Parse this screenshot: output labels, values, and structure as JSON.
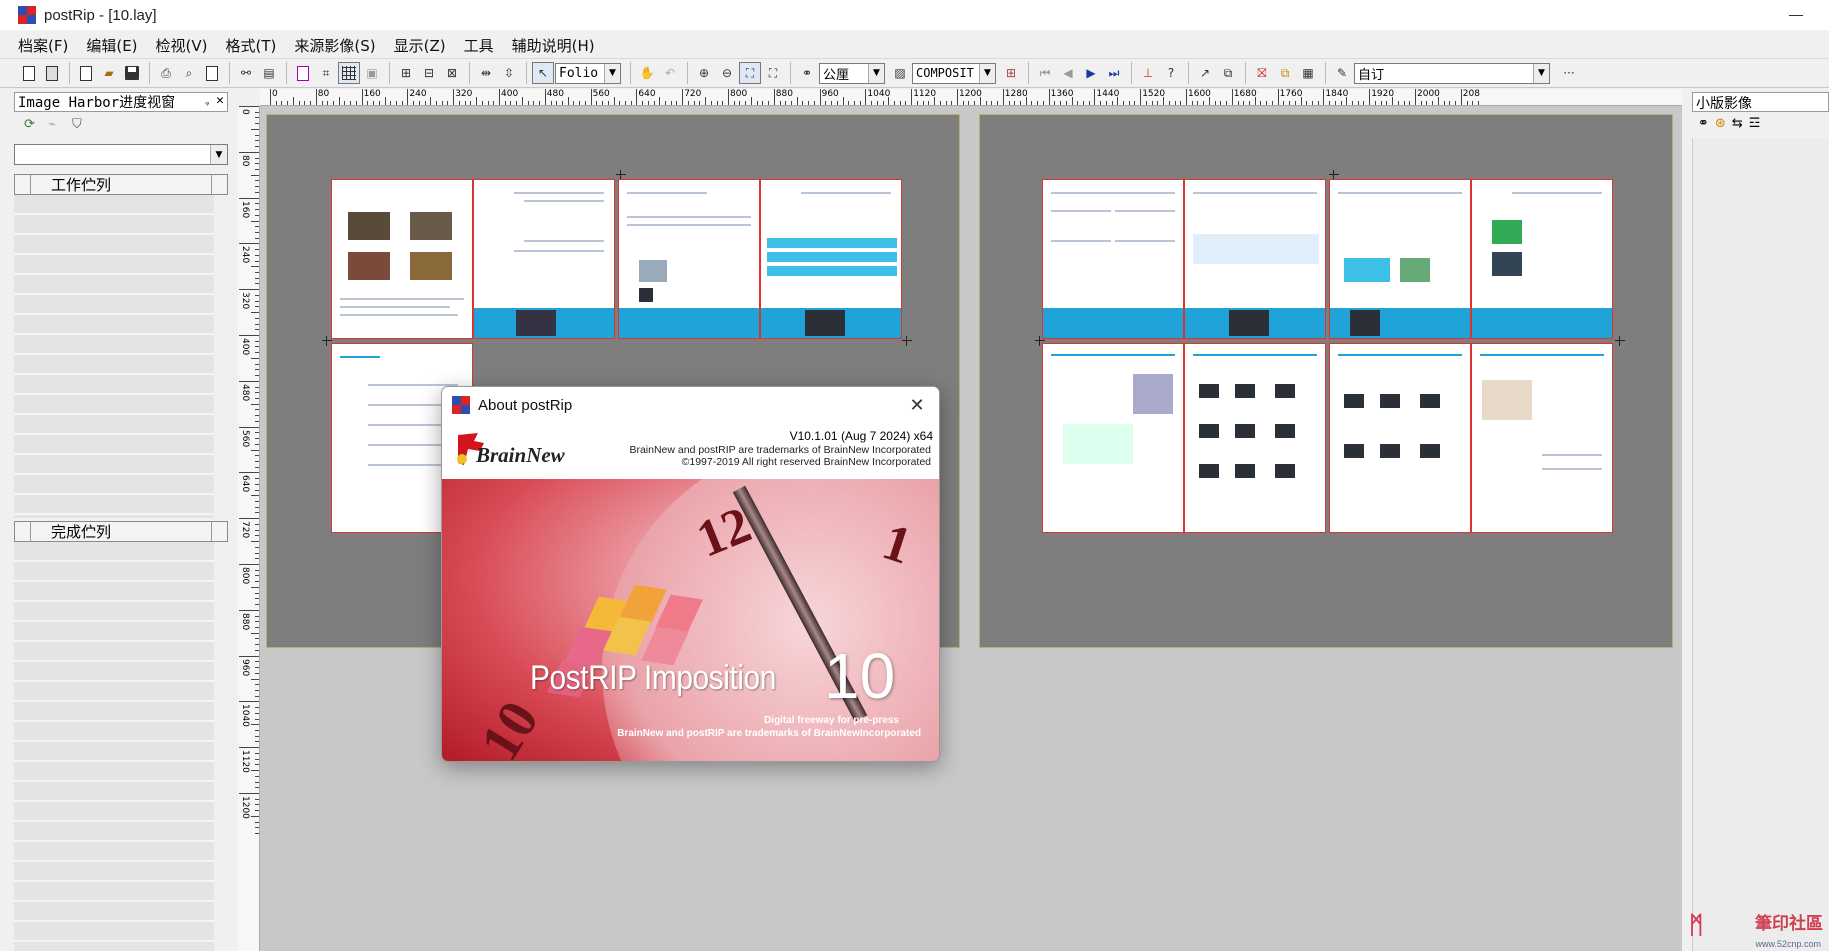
{
  "window": {
    "title": "postRip - [10.lay]"
  },
  "menu": [
    {
      "label": "档案(F)"
    },
    {
      "label": "编辑(E)"
    },
    {
      "label": "检视(V)"
    },
    {
      "label": "格式(T)"
    },
    {
      "label": "来源影像(S)"
    },
    {
      "label": "显示(Z)"
    },
    {
      "label": "工具"
    },
    {
      "label": "辅助说明(H)"
    }
  ],
  "toolbar": {
    "folio_value": "Folio",
    "unit_value": "公厘",
    "mode_value": "COMPOSIT",
    "custom_value": "自订",
    "overflow": "···"
  },
  "left_panel": {
    "title": "Image Harbor进度视窗",
    "pin": "ᵩ",
    "close": "✕",
    "work_list": "工作伫列",
    "done_list": "完成伫列"
  },
  "right_panel": {
    "title": "小版影像"
  },
  "ruler": {
    "h_labels": [
      "0",
      "80",
      "160",
      "240",
      "320",
      "400",
      "480",
      "560",
      "640",
      "720",
      "800",
      "880",
      "960",
      "1040",
      "1120",
      "1200",
      "1280",
      "1360",
      "1440",
      "1520",
      "1600",
      "1680",
      "1760",
      "1840",
      "1920",
      "2000",
      "208"
    ],
    "v_labels": [
      "0",
      "80",
      "160",
      "240",
      "320",
      "400",
      "480",
      "560",
      "640",
      "720",
      "800",
      "880",
      "960",
      "1040",
      "1120",
      "1200"
    ]
  },
  "about": {
    "title": "About postRip",
    "brand": "BrainNew",
    "version": "V10.1.01 (Aug  7 2024)  x64",
    "trademark": "BrainNew and postRIP are trademarks of BrainNew Incorporated",
    "copyright": "©1997-2019 All right reserved BrainNew Incorporated",
    "product": "PostRIP Imposition",
    "product_num": "10",
    "tagline": "Digital freeway for pre-press",
    "tagline2": "BrainNew and postRIP are trademarks of BrainNewIncorporated",
    "dial_12": "12",
    "dial_1": "1",
    "dial_10": "10"
  },
  "watermark": {
    "main": "筆印社區",
    "sub": "www.52cnp.com"
  },
  "colors": {
    "accent_blue": "#1fa3d8",
    "page_border": "#dd3333",
    "splash_red": "#d84a55"
  }
}
